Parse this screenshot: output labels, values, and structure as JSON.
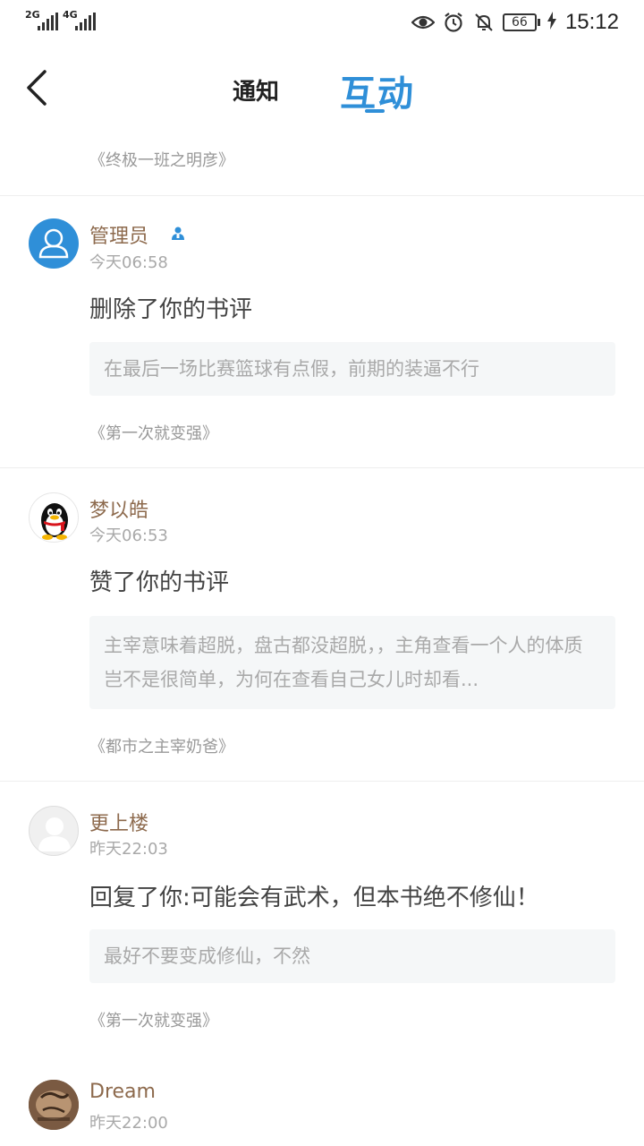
{
  "status_bar": {
    "network1": "2G",
    "network2": "4G",
    "battery": "66",
    "time": "15:12",
    "icons": [
      "eye-icon",
      "alarm-icon",
      "bell-off-icon",
      "battery-icon",
      "charging-icon"
    ]
  },
  "header": {
    "tab_notice": "通知",
    "tab_interact": "互动",
    "accent_color": "#2f8fd8"
  },
  "top_book": "《终极一班之明彦》",
  "items": [
    {
      "user": "管理员",
      "time": "今天06:58",
      "action": "删除了你的书评",
      "quote": "在最后一场比赛篮球有点假，前期的装逼不行",
      "book": "《第一次就变强》",
      "avatar": "default-blue-avatar"
    },
    {
      "user": "梦以皓",
      "time": "今天06:53",
      "action": "赞了你的书评",
      "quote": "主宰意味着超脱，盘古都没超脱，，主角查看一个人的体质岂不是很简单，为何在查看自己女儿时却看...",
      "book": "《都市之主宰奶爸》",
      "avatar": "penguin-avatar"
    },
    {
      "user": "更上楼",
      "time": "昨天22:03",
      "action": "回复了你:可能会有武术，但本书绝不修仙！",
      "quote": "最好不要变成修仙，不然",
      "book": "《第一次就变强》",
      "avatar": "default-gray-avatar"
    },
    {
      "user": "Dream",
      "time": "昨天22:00",
      "avatar": "photo-avatar"
    }
  ],
  "colors": {
    "username": "#8d6a4d",
    "meta": "#a9a9a9",
    "quote_bg": "#f5f7f8"
  }
}
